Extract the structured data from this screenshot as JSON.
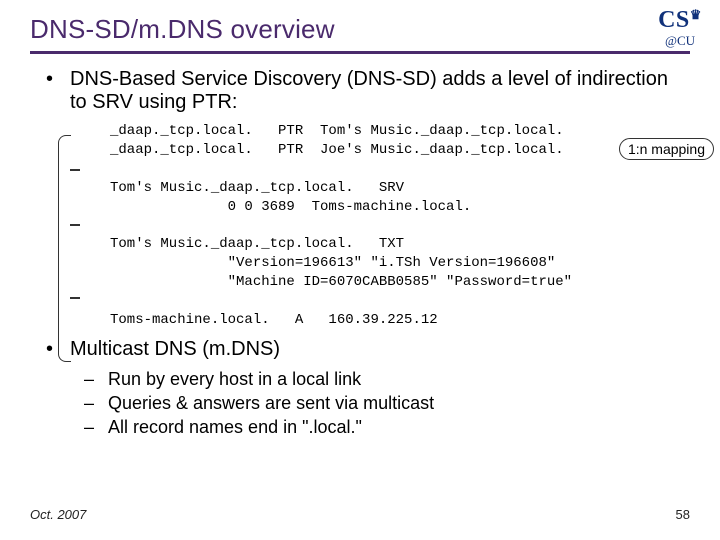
{
  "logo": {
    "top": "CS",
    "crown": "♛",
    "bottom": "@CU"
  },
  "title": "DNS-SD/m.DNS overview",
  "bullet1": "DNS-Based Service Discovery (DNS-SD) adds a level of indirection to SRV using PTR:",
  "code": {
    "l1": "_daap._tcp.local.   PTR  Tom's Music._daap._tcp.local.",
    "l2": "_daap._tcp.local.   PTR  Joe's Music._daap._tcp.local.",
    "l3": "",
    "l4": "Tom's Music._daap._tcp.local.   SRV",
    "l5": "              0 0 3689  Toms-machine.local.",
    "l6": "",
    "l7": "Tom's Music._daap._tcp.local.   TXT",
    "l8": "              \"Version=196613\" \"i.TSh Version=196608\"",
    "l9": "              \"Machine ID=6070CABB0585\" \"Password=true\"",
    "l10": "",
    "l11": "Toms-machine.local.   A   160.39.225.12"
  },
  "callout_nmap": "1:n mapping",
  "bullet2": "Multicast DNS (m.DNS)",
  "sub1": "Run by every host in a local link",
  "sub2": "Queries & answers are sent via multicast",
  "sub3": "All record names end in \".local.\"",
  "footer_date": "Oct. 2007",
  "footer_page": "58"
}
